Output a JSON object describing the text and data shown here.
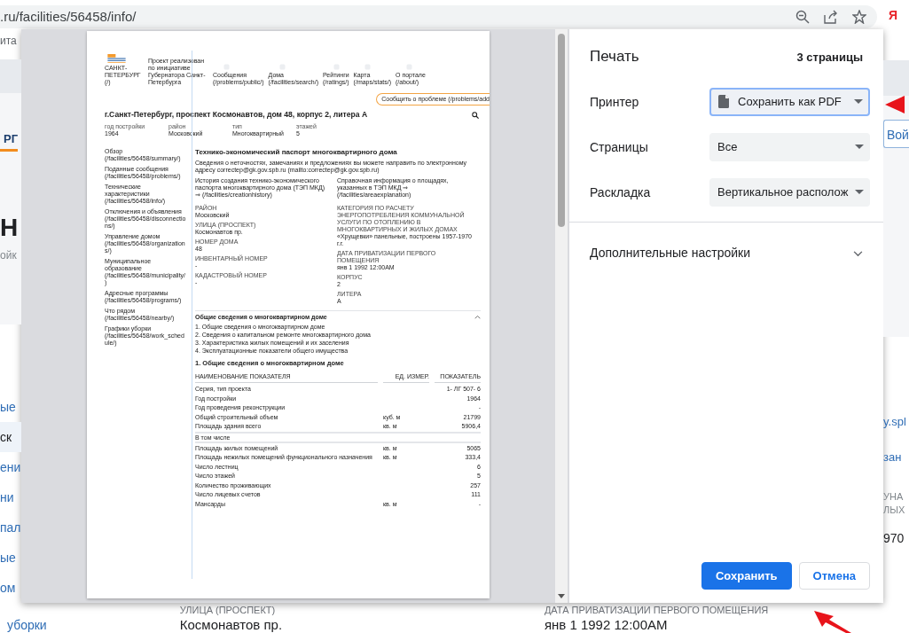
{
  "browser": {
    "url": ".ru/facilities/56458/info/",
    "profile": "Я"
  },
  "background_page": {
    "left": {
      "top_text": "ита",
      "logo_text": "РГ",
      "heading": "Н",
      "subheading": "ойк",
      "links": [
        {
          "text": "ые",
          "selected": false
        },
        {
          "text": "ск",
          "selected": true
        },
        {
          "text": "ени",
          "selected": false
        },
        {
          "text": "ни",
          "selected": false
        },
        {
          "text": "пал",
          "selected": false
        },
        {
          "text": "ые",
          "selected": false
        },
        {
          "text": "ом",
          "selected": false
        }
      ],
      "bottom_link": "уборки"
    },
    "right": {
      "button": "Вой",
      "links": [
        "y.spl",
        "зан"
      ],
      "label_lines": [
        "УНА",
        "ЛЫХ"
      ],
      "value": "970"
    },
    "bottom_fields": [
      {
        "label": "УЛИЦА (ПРОСПЕКТ)",
        "value": "Космонавтов пр."
      },
      {
        "label": "ДАТА ПРИВАТИЗАЦИИ ПЕРВОГО ПОМЕЩЕНИЯ",
        "value": "янв 1 1992 12:00AM"
      }
    ]
  },
  "preview": {
    "logo_link": "(/)",
    "logo_text": "САНКТ-ПЕТЕРБУРГ",
    "project_note": "Проект реализован по инициативе Губернатора Санкт-Петербурга",
    "nav": [
      {
        "label": "Сообщения",
        "href": "(/problems/public/)"
      },
      {
        "label": "Дома",
        "href": "(/facilities/search/)"
      },
      {
        "label": "Рейтинги",
        "href": "(/ratings/)"
      },
      {
        "label": "Карта",
        "href": "(/maps/stats/)"
      },
      {
        "label": "О портале",
        "href": "(/about/)"
      }
    ],
    "report_button": "Сообщить о проблеме (/problems/add",
    "title": "г.Санкт-Петербург, проспект Космонавтов, дом 48, корпус 2, литера А",
    "facts": [
      {
        "label": "год постройки",
        "value": "1964"
      },
      {
        "label": "район",
        "value": "Московский"
      },
      {
        "label": "тип",
        "value": "Многоквартирный"
      },
      {
        "label": "этажей",
        "value": "5"
      }
    ],
    "side_links": [
      "Обзор (/facilities/56458/summary/)",
      "Поданные сообщения (/facilities/56458/problems/)",
      "Технические характеристики (/facilities/56458/info/)",
      "Отключения и объявления (/facilities/56458/disconnections/)",
      "Управление домом (/facilities/56458/organizations/)",
      "Муниципальное образование (/facilities/56458/municipality/)",
      "Адресные программы (/facilities/56458/programs/)",
      "Что рядом (/facilities/56458/nearby/)",
      "Графики уборки (/facilities/56458/work_schedule/)"
    ],
    "passport_title": "Технико-экономический паспорт многоквартирного дома",
    "passport_note": "Сведения о неточностях, замечаниях и предложениях вы можете направить по электронному адресу correctep@gk.gov.spb.ru (mailto:correctep@gk.gov.spb.ru)",
    "passport_links": [
      "История создания технико-экономического паспорта многоквартирного дома (ТЭП МКД) ⇒ (/facilities/creationhistory)",
      "Справочная информация о площадях, указанных в ТЭП МКД ⇒ (/facilities/areaexplanation)"
    ],
    "fields_left": [
      {
        "label": "РАЙОН",
        "value": "Московский"
      },
      {
        "label": "УЛИЦА (ПРОСПЕКТ)",
        "value": "Космонавтов пр."
      },
      {
        "label": "НОМЕР ДОМА",
        "value": "48"
      },
      {
        "label": "ИНВЕНТАРНЫЙ НОМЕР",
        "value": "-"
      },
      {
        "label": "КАДАСТРОВЫЙ НОМЕР",
        "value": "-"
      }
    ],
    "fields_right": [
      {
        "label": "КАТЕГОРИЯ ПО РАСЧЕТУ ЭНЕРГОПОТРЕБЛЕНИЯ КОММУНАЛЬНОЙ УСЛУГИ ПО ОТОПЛЕНИЮ В МНОГОКВАРТИРНЫХ И ЖИЛЫХ ДОМАХ",
        "value": "«Хрущевки» панельные, построены 1957-1970 г.г."
      },
      {
        "label": "ДАТА ПРИВАТИЗАЦИИ ПЕРВОГО ПОМЕЩЕНИЯ",
        "value": "янв 1 1992 12:00AM"
      },
      {
        "label": "КОРПУС",
        "value": "2"
      },
      {
        "label": "ЛИТЕРА",
        "value": "А"
      }
    ],
    "accordion": {
      "title": "Общие сведения о многоквартирном доме",
      "expanded": true,
      "items": [
        "1. Общие сведения о многоквартирном доме",
        "2. Сведения о капитальном ремонте многоквартирного дома",
        "3. Характеристика жилых помещений и их заселения",
        "4. Эксплуатационные показатели общего имущества"
      ]
    },
    "section_title": "1. Общие сведения о многоквартирном доме",
    "table": {
      "columns": [
        "НАИМЕНОВАНИЕ ПОКАЗАТЕЛЯ",
        "ЕД. ИЗМЕР.",
        "ПОКАЗАТЕЛЬ"
      ],
      "rows": [
        {
          "kind": "row",
          "name": "Серия, тип проекта",
          "value": "1- ЛГ 507- 6"
        },
        {
          "kind": "row",
          "name": "Год постройки",
          "value": "1964"
        },
        {
          "kind": "row",
          "name": "Год проведения реконструкции",
          "value": "-"
        },
        {
          "kind": "row",
          "name": "Общий строительный объем",
          "unit": "куб. м",
          "value": "21799"
        },
        {
          "kind": "row",
          "name": "Площадь здания всего",
          "unit": "кв. м",
          "value": "5906,4"
        },
        {
          "kind": "subheader",
          "name": "В том числе"
        },
        {
          "kind": "row",
          "name": "Площадь жилых помещений",
          "unit": "кв. м",
          "value": "5065"
        },
        {
          "kind": "row",
          "name": "Площадь нежилых помещений функционального назначения",
          "unit": "кв. м",
          "value": "333,4"
        },
        {
          "kind": "row",
          "name": "Число лестниц",
          "value": "6"
        },
        {
          "kind": "row",
          "name": "Число этажей",
          "value": "5"
        },
        {
          "kind": "row",
          "name": "Количество проживающих",
          "value": "257"
        },
        {
          "kind": "row",
          "name": "Число лицевых счетов",
          "value": "111"
        },
        {
          "kind": "row",
          "name": "Мансарды",
          "unit": "кв. м",
          "value": "-"
        }
      ]
    }
  },
  "print_dialog": {
    "title": "Печать",
    "page_count": "3 страницы",
    "settings": [
      {
        "label": "Принтер",
        "value": "Сохранить как PDF",
        "kind": "destination",
        "focused": true
      },
      {
        "label": "Страницы",
        "value": "Все",
        "kind": "choice",
        "focused": false
      },
      {
        "label": "Раскладка",
        "value": "Вертикальное располож",
        "kind": "choice",
        "focused": false
      }
    ],
    "more_settings": {
      "label": "Дополнительные настройки",
      "expanded": false
    },
    "buttons": [
      {
        "label": "Сохранить",
        "kind": "primary"
      },
      {
        "label": "Отмена",
        "kind": "secondary"
      }
    ]
  }
}
